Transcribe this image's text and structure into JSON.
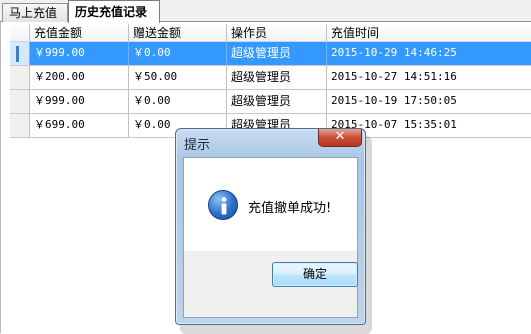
{
  "tabs": [
    {
      "label": "马上充值"
    },
    {
      "label": "历史充值记录"
    }
  ],
  "grid": {
    "columns": [
      "充值金额",
      "赠送金额",
      "操作员",
      "充值时间"
    ],
    "rows": [
      {
        "amount": "￥999.00",
        "bonus": "￥0.00",
        "operator": "超级管理员",
        "time": "2015-10-29 14:46:25",
        "selected": true
      },
      {
        "amount": "￥200.00",
        "bonus": "￥50.00",
        "operator": "超级管理员",
        "time": "2015-10-27 14:51:16"
      },
      {
        "amount": "￥999.00",
        "bonus": "￥0.00",
        "operator": "超级管理员",
        "time": "2015-10-19 17:50:05"
      },
      {
        "amount": "￥699.00",
        "bonus": "￥0.00",
        "operator": "超级管理员",
        "time": "2015-10-07 15:35:01"
      }
    ]
  },
  "dialog": {
    "title": "提示",
    "close_label": "✕",
    "icon": "info-icon",
    "message": "充值撤单成功!",
    "ok_label": "确定"
  },
  "colors": {
    "selection": "#3399ff",
    "dialog_frame": "#a9c6e6",
    "close_button": "#c9503b"
  }
}
